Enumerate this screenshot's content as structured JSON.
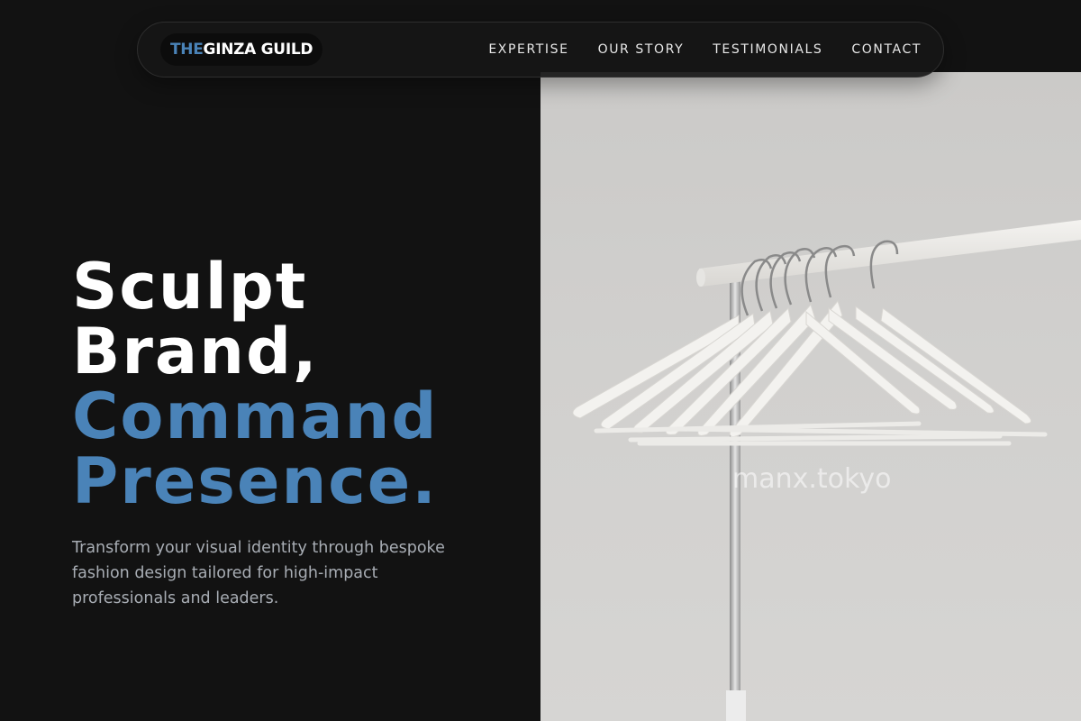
{
  "brand": {
    "part1": "THE",
    "part2": "GINZA GUILD"
  },
  "nav": {
    "items": [
      "EXPERTISE",
      "OUR STORY",
      "TESTIMONIALS",
      "CONTACT"
    ]
  },
  "hero": {
    "line1": "Sculpt",
    "line2": "Brand,",
    "line3": "Command",
    "line4": "Presence.",
    "subtitle": "Transform your visual identity through bespoke fashion design tailored for high-impact professionals and leaders."
  },
  "image": {
    "watermark": "manx.tokyo",
    "subject": "white-hangers-on-clothing-rack"
  },
  "colors": {
    "background": "#121212",
    "accent": "#4a83b8",
    "text": "#ffffff",
    "muted": "#a8adb4"
  }
}
